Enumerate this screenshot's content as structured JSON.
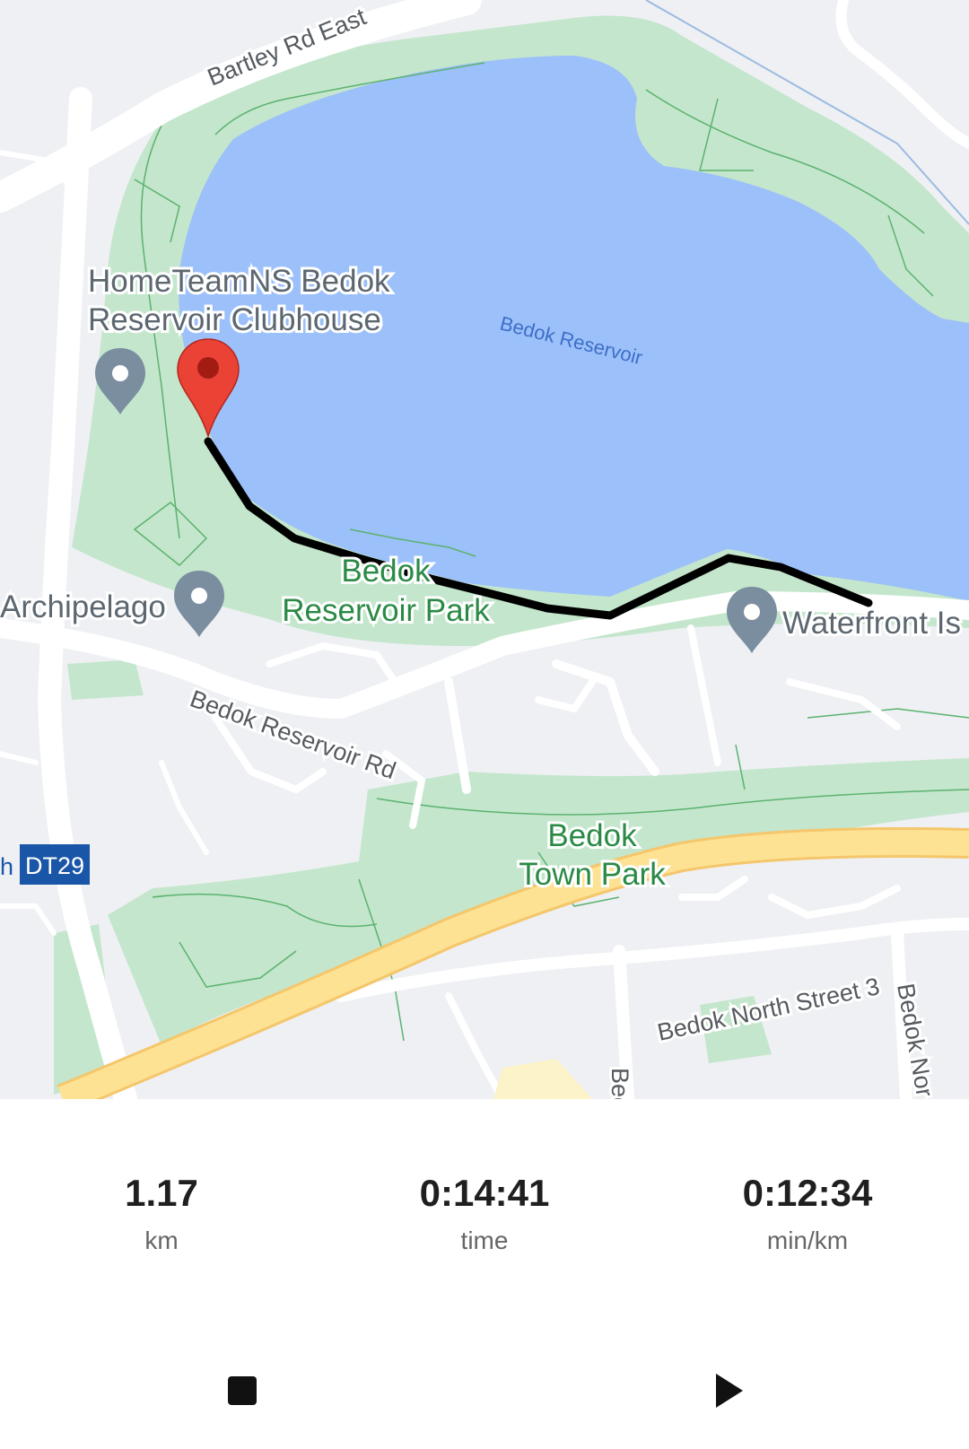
{
  "map": {
    "water_label": "Bedok Reservoir",
    "road_labels": {
      "bartley": "Bartley Rd East",
      "bedok_reservoir_rd": "Bedok Reservoir Rd",
      "bedok_north_st3": "Bedok North Street 3",
      "bedok_north_partial": "Bedok Nor",
      "bedok_partial": "Bec"
    },
    "poi_labels": {
      "clubhouse_line1": "HomeTeamNS Bedok",
      "clubhouse_line2": "Reservoir Clubhouse",
      "archipelago": "Archipelago",
      "waterfront": "Waterfront Is"
    },
    "park_labels": {
      "reservoir_park_line1": "Bedok",
      "reservoir_park_line2": "Reservoir Park",
      "town_park_line1": "Bedok",
      "town_park_line2": "Town Park"
    },
    "station": {
      "prefix": "h",
      "code": "DT29"
    },
    "colors": {
      "water": "#9cc0f9",
      "park": "#c4e6cc",
      "road": "#ffffff",
      "expressway": "#fde293",
      "route": "#000000",
      "pin_red": "#ea4335",
      "pin_gray": "#7a8ea0"
    },
    "icons": {
      "current_location": "red-map-pin-icon",
      "poi_marker": "gray-map-pin-icon"
    }
  },
  "stats": {
    "distance": {
      "value": "1.17",
      "unit": "km"
    },
    "time": {
      "value": "0:14:41",
      "unit": "time"
    },
    "pace": {
      "value": "0:12:34",
      "unit": "min/km"
    }
  },
  "controls": {
    "stop_icon": "stop-icon",
    "play_icon": "play-icon"
  }
}
